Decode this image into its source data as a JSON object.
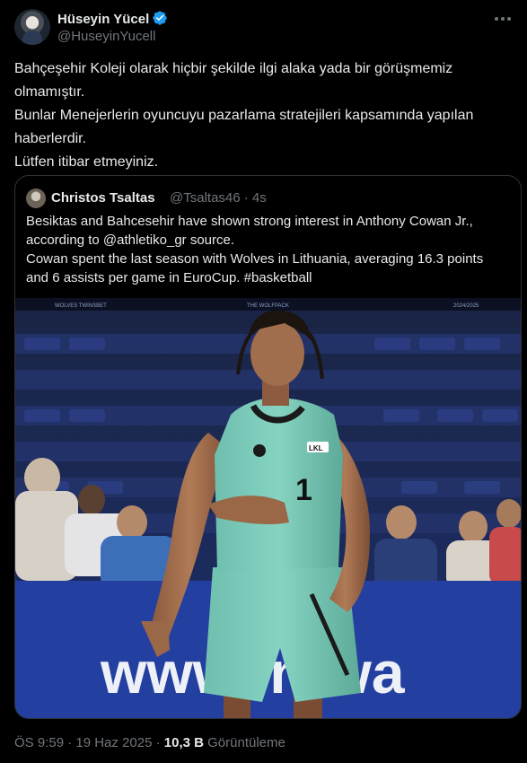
{
  "tweet": {
    "author_name": "Hüseyin Yücel",
    "author_handle": "@HuseyinYucell",
    "text_lines": [
      "Bahçeşehir Koleji olarak hiçbir şekilde ilgi alaka yada bir görüşmemiz",
      "olmamıştır.",
      "Bunlar Menejerlerin oyuncuyu pazarlama stratejileri kapsamında yapılan",
      "haberlerdir.",
      "Lütfen itibar etmeyiniz."
    ]
  },
  "quoted": {
    "author_name": "Christos Tsaltas",
    "author_handle": "@Tsaltas46 · 4s",
    "text_lines": [
      "Besiktas and Bahcesehir have shown strong interest in Anthony Cowan Jr.,",
      "according to @athletiko_gr source.",
      "Cowan spent the last season with Wolves in Lithuania, averaging 16.3 points",
      "and 6 assists per game in EuroCup. #basketball"
    ],
    "photo_banner_top_left": "WOLVES TWINSBET",
    "photo_banner_top_center": "THE WOLFPACK",
    "photo_banner_top_right": "2024/2025",
    "photo_board_text": "www.intwa",
    "jersey_number": "1",
    "jersey_badge": "LKL"
  },
  "footer": {
    "time": "ÖS 9:59 · 19 Haz 2025 · ",
    "views_count": "10,3 B",
    "views_label": " Görüntüleme"
  },
  "colors": {
    "background": "#000000",
    "text": "#e7e9ea",
    "muted": "#71767b",
    "verified": "#1d9bf0",
    "border": "#2f3336",
    "jersey": "#79c9b8"
  }
}
